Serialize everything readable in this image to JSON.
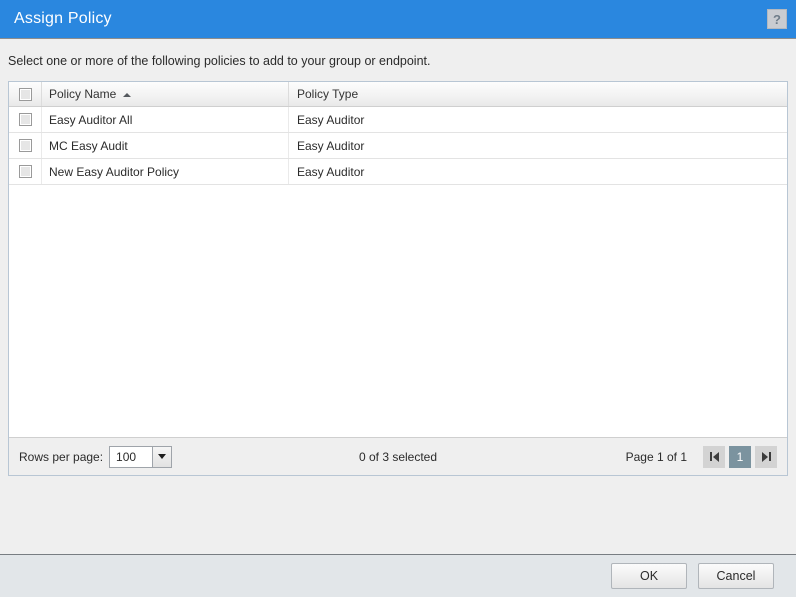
{
  "titlebar": {
    "title": "Assign Policy",
    "help_icon": "question-mark-icon",
    "help_glyph": "?",
    "background_color": "#2a87df"
  },
  "instruction": "Select one or more of the following policies to add to your group or endpoint.",
  "grid": {
    "columns": [
      {
        "key": "select",
        "label": ""
      },
      {
        "key": "policy_name",
        "label": "Policy Name",
        "sorted": "ascending",
        "sort_glyph": "▲"
      },
      {
        "key": "policy_type",
        "label": "Policy Type"
      }
    ],
    "rows": [
      {
        "checked": false,
        "policy_name": "Easy Auditor All",
        "policy_type": "Easy Auditor"
      },
      {
        "checked": false,
        "policy_name": "MC Easy Audit",
        "policy_type": "Easy Auditor"
      },
      {
        "checked": false,
        "policy_name": "New Easy Auditor Policy",
        "policy_type": "Easy Auditor"
      }
    ]
  },
  "footer": {
    "rows_per_page_label": "Rows per page:",
    "rows_per_page_value": "100",
    "rows_per_page_options": [
      "100"
    ],
    "selected_count": "0 of 3 selected",
    "page_label": "Page 1 of 1",
    "first_page_icon": "first-page-icon",
    "last_page_icon": "last-page-icon",
    "current_page": "1",
    "active_page_color": "#7b939f"
  },
  "buttons": {
    "ok": "OK",
    "cancel": "Cancel"
  }
}
